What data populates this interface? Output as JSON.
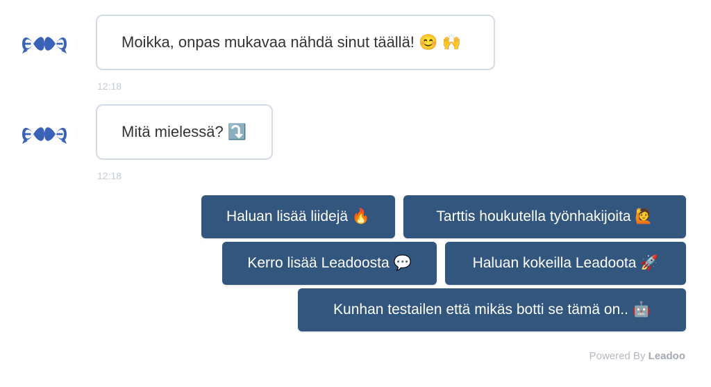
{
  "messages": [
    {
      "text": "Moikka, onpas mukavaa nähdä sinut täällä! 😊 🙌",
      "time": "12:18"
    },
    {
      "text": "Mitä mielessä? ⤵️",
      "time": "12:18"
    }
  ],
  "quick_replies": [
    {
      "label": "Haluan lisää liidejä 🔥"
    },
    {
      "label": "Tarttis houkutella työnhakijoita 🙋"
    },
    {
      "label": "Kerro lisää Leadoosta 💬"
    },
    {
      "label": "Haluan kokeilla Leadoota 🚀"
    },
    {
      "label": "Kunhan testailen että mikäs botti se tämä on.. 🤖"
    }
  ],
  "footer": {
    "powered_prefix": "Powered By",
    "brand": "Leadoo"
  },
  "colors": {
    "accent": "#33567f",
    "logo": "#3a63b8",
    "bubble_border": "#d3dbe6"
  },
  "icons": {
    "avatar": "leadoo-infinity-chat-logo"
  }
}
